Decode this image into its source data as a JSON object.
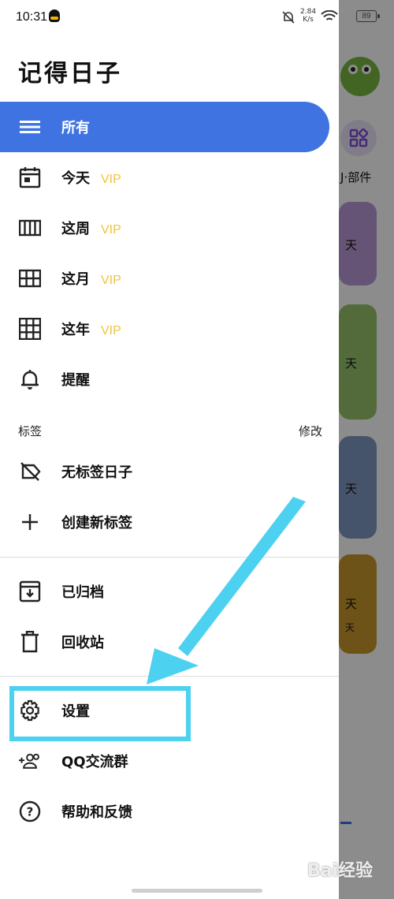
{
  "status_bar": {
    "time": "10:31",
    "speed": "2.84",
    "speed_unit": "K/s",
    "battery": "89"
  },
  "app_title": "记得日子",
  "nav_primary": [
    {
      "label": "所有",
      "icon": "list-icon",
      "vip": "",
      "active": true
    },
    {
      "label": "今天",
      "icon": "calendar-day-icon",
      "vip": "VIP"
    },
    {
      "label": "这周",
      "icon": "calendar-week-icon",
      "vip": "VIP"
    },
    {
      "label": "这月",
      "icon": "calendar-month-icon",
      "vip": "VIP"
    },
    {
      "label": "这年",
      "icon": "calendar-year-icon",
      "vip": "VIP"
    },
    {
      "label": "提醒",
      "icon": "bell-icon",
      "vip": ""
    }
  ],
  "tags_section": {
    "title": "标签",
    "edit_label": "修改",
    "items": [
      {
        "label": "无标签日子",
        "icon": "no-tag-icon"
      },
      {
        "label": "创建新标签",
        "icon": "plus-icon"
      }
    ]
  },
  "nav_secondary": [
    {
      "label": "已归档",
      "icon": "archive-icon"
    },
    {
      "label": "回收站",
      "icon": "trash-icon"
    }
  ],
  "nav_tertiary": [
    {
      "label": "设置",
      "icon": "gear-icon"
    },
    {
      "label": "QQ交流群",
      "icon": "group-add-icon"
    },
    {
      "label": "帮助和反馈",
      "icon": "help-icon"
    }
  ],
  "background": {
    "widget_label": "J·部件",
    "cards": [
      {
        "text": "天",
        "color": "#ba9ad8"
      },
      {
        "text": "天",
        "color": "#98c46a"
      },
      {
        "text": "天",
        "color": "#7f98c4"
      },
      {
        "text": "天",
        "text2": "天",
        "color": "#c7982a"
      }
    ]
  },
  "annotation": {
    "highlight_color": "#4dd1f0"
  },
  "watermark": "Bai经验",
  "colors": {
    "accent": "#3e73e1",
    "vip": "#f0c33c"
  }
}
